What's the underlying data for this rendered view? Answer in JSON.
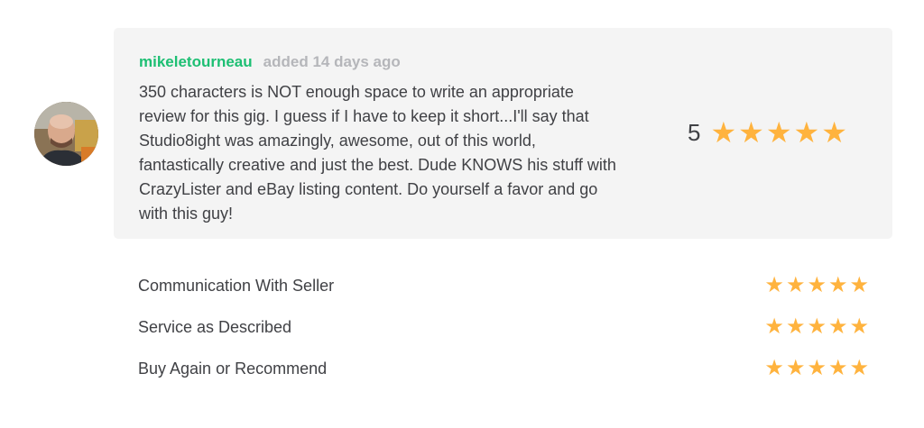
{
  "review": {
    "username": "mikeletourneau",
    "added_text": "added 14 days ago",
    "body": "350 characters is NOT enough space to write an appropriate review for this gig. I guess if I have to keep it short...I'll say that Studio8ight was amazingly, awesome, out of this world, fantastically creative and just the best. Dude KNOWS his stuff with CrazyLister and eBay listing content. Do yourself a favor and go with this guy!",
    "overall_rating": "5",
    "overall_stars": 5,
    "star_color": "#ffb33e",
    "username_color": "#1dbf73",
    "star_icon": "star-icon"
  },
  "breakdown": [
    {
      "label": "Communication With Seller",
      "stars": 5
    },
    {
      "label": "Service as Described",
      "stars": 5
    },
    {
      "label": "Buy Again or Recommend",
      "stars": 5
    }
  ]
}
